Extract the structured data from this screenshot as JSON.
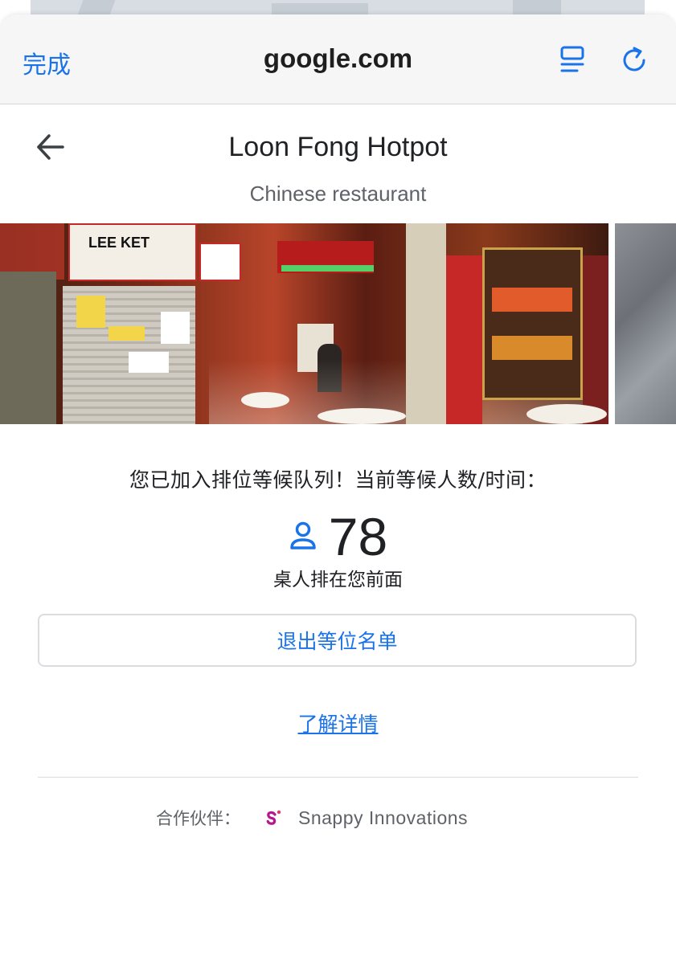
{
  "browser": {
    "done_label": "完成",
    "url": "google.com",
    "icons": [
      "reader-view-icon",
      "reload-icon"
    ],
    "accent_color": "#1a73e8"
  },
  "header": {
    "back_icon": "arrow-left-icon",
    "title": "Loon Fong Hotpot",
    "subtitle": "Chinese restaurant"
  },
  "photo": {
    "sign_text": "LEE KET"
  },
  "queue": {
    "message": "您已加入排位等候队列！当前等候人数/时间：",
    "icon": "person-icon",
    "count": "78",
    "ahead_label": "桌人排在您前面"
  },
  "actions": {
    "leave_label": "退出等位名单",
    "learn_more_label": "了解详情"
  },
  "partner": {
    "label": "合作伙伴：",
    "name": "Snappy Innovations",
    "logo_color": "#b5178c"
  }
}
